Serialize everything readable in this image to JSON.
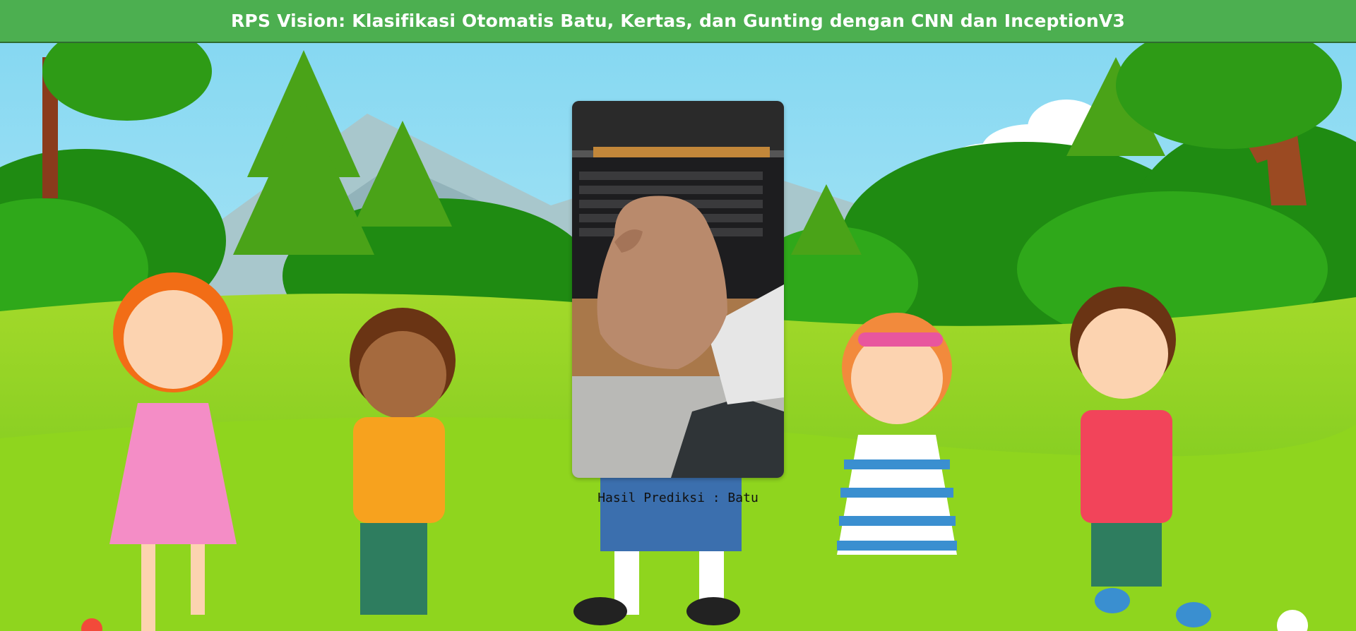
{
  "header": {
    "title": "RPS Vision: Klasifikasi Otomatis Batu, Kertas, dan Gunting dengan CNN dan InceptionV3"
  },
  "background": {
    "icon": "cartoon-playground-kids-illustration"
  },
  "preview": {
    "icon": "uploaded-hand-photo-icon"
  },
  "result": {
    "label": "Hasil Prediksi : Batu"
  },
  "colors": {
    "header": "#4caf50",
    "sky": "#8fdcf2",
    "grass": "#7fcf1e"
  }
}
